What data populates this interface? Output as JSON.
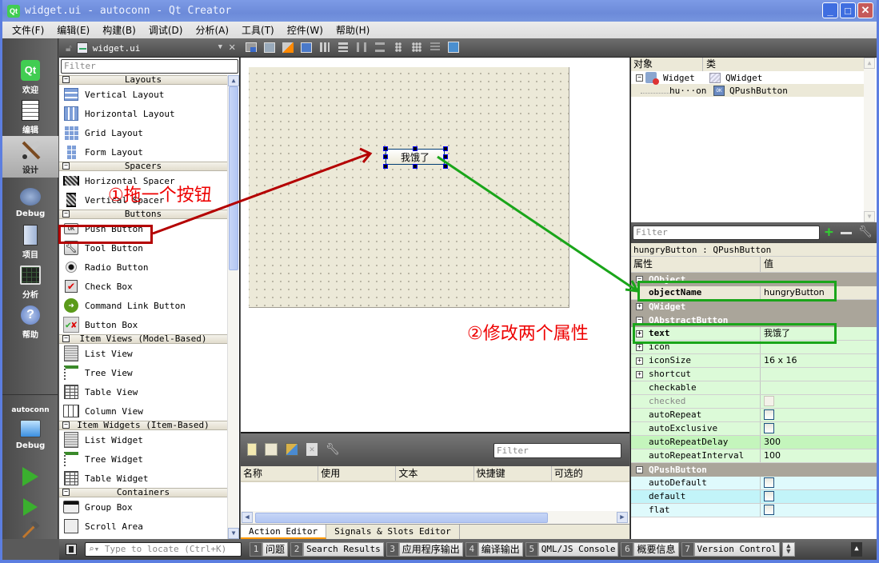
{
  "window": {
    "title": "widget.ui - autoconn - Qt Creator",
    "app_icon": "qt-logo-icon",
    "buttons": [
      "minimize",
      "maximize",
      "close"
    ]
  },
  "menubar": {
    "items": [
      "文件(F)",
      "编辑(E)",
      "构建(B)",
      "调试(D)",
      "分析(A)",
      "工具(T)",
      "控件(W)",
      "帮助(H)"
    ]
  },
  "modebar": {
    "modes": [
      {
        "label": "欢迎",
        "icon": "qt-welcome-icon"
      },
      {
        "label": "编辑",
        "icon": "edit-document-icon"
      },
      {
        "label": "设计",
        "icon": "design-brush-icon",
        "active": true
      },
      {
        "label": "Debug",
        "icon": "debug-bug-icon"
      },
      {
        "label": "项目",
        "icon": "project-folder-icon"
      },
      {
        "label": "分析",
        "icon": "analyze-monitor-icon"
      },
      {
        "label": "帮助",
        "icon": "help-icon"
      }
    ],
    "target": {
      "project": "autoconn",
      "config": "Debug"
    },
    "actions": [
      "run-icon",
      "debug-run-icon",
      "build-hammer-icon"
    ]
  },
  "editor_toolbar": {
    "document": "widget.ui",
    "form_tools": [
      "edit-widgets",
      "edit-signals-slots",
      "edit-buddies",
      "edit-tab-order",
      "layout-horizontal",
      "layout-vertical",
      "layout-horizontal-splitter",
      "layout-vertical-splitter",
      "layout-form",
      "layout-grid",
      "break-layout",
      "adjust-size"
    ]
  },
  "widgetbox": {
    "filter_placeholder": "Filter",
    "categories": [
      {
        "name": "Layouts",
        "items": [
          {
            "label": "Vertical Layout",
            "icon": "vertical-layout-icon"
          },
          {
            "label": "Horizontal Layout",
            "icon": "horizontal-layout-icon"
          },
          {
            "label": "Grid Layout",
            "icon": "grid-layout-icon"
          },
          {
            "label": "Form Layout",
            "icon": "form-layout-icon"
          }
        ]
      },
      {
        "name": "Spacers",
        "items": [
          {
            "label": "Horizontal Spacer",
            "icon": "horizontal-spacer-icon"
          },
          {
            "label": "Vertical Spacer",
            "icon": "vertical-spacer-icon"
          }
        ]
      },
      {
        "name": "Buttons",
        "items": [
          {
            "label": "Push Button",
            "icon": "push-button-icon"
          },
          {
            "label": "Tool Button",
            "icon": "tool-button-icon"
          },
          {
            "label": "Radio Button",
            "icon": "radio-button-icon"
          },
          {
            "label": "Check Box",
            "icon": "check-box-icon"
          },
          {
            "label": "Command Link Button",
            "icon": "command-link-icon"
          },
          {
            "label": "Button Box",
            "icon": "button-box-icon"
          }
        ]
      },
      {
        "name": "Item Views (Model-Based)",
        "items": [
          {
            "label": "List View",
            "icon": "list-view-icon"
          },
          {
            "label": "Tree View",
            "icon": "tree-view-icon"
          },
          {
            "label": "Table View",
            "icon": "table-view-icon"
          },
          {
            "label": "Column View",
            "icon": "column-view-icon"
          }
        ]
      },
      {
        "name": "Item Widgets (Item-Based)",
        "items": [
          {
            "label": "List Widget",
            "icon": "list-widget-icon"
          },
          {
            "label": "Tree Widget",
            "icon": "tree-widget-icon"
          },
          {
            "label": "Table Widget",
            "icon": "table-widget-icon"
          }
        ]
      },
      {
        "name": "Containers",
        "items": [
          {
            "label": "Group Box",
            "icon": "group-box-icon"
          },
          {
            "label": "Scroll Area",
            "icon": "scroll-area-icon"
          }
        ]
      }
    ]
  },
  "form": {
    "button_text": "我饿了"
  },
  "action_editor": {
    "filter_placeholder": "Filter",
    "columns": [
      "名称",
      "使用",
      "文本",
      "快捷键",
      "可选的"
    ],
    "tabs": [
      "Action Editor",
      "Signals & Slots Editor"
    ],
    "active_tab": "Action Editor"
  },
  "object_inspector": {
    "columns": [
      "对象",
      "类"
    ],
    "rows": [
      {
        "object": "Widget",
        "class": "QWidget"
      },
      {
        "object": "hu···on",
        "class": "QPushButton"
      }
    ]
  },
  "property_editor": {
    "filter_placeholder": "Filter",
    "class_line": "hungryButton : QPushButton",
    "columns": [
      "属性",
      "值"
    ],
    "groups": [
      {
        "name": "QObject",
        "expanded": true,
        "props": [
          {
            "name": "objectName",
            "value": "hungryButton",
            "bold": true
          }
        ]
      },
      {
        "name": "QWidget",
        "expanded": false,
        "props": []
      },
      {
        "name": "QAbstractButton",
        "expanded": true,
        "props": [
          {
            "name": "text",
            "value": "我饿了",
            "bold": true,
            "expandable": true
          },
          {
            "name": "icon",
            "value": "",
            "expandable": true
          },
          {
            "name": "iconSize",
            "value": "16 x 16",
            "expandable": true
          },
          {
            "name": "shortcut",
            "value": "",
            "expandable": true
          },
          {
            "name": "checkable",
            "value": ""
          },
          {
            "name": "checked",
            "checkbox": false,
            "disabled": true
          },
          {
            "name": "autoRepeat",
            "checkbox": false
          },
          {
            "name": "autoExclusive",
            "checkbox": false
          },
          {
            "name": "autoRepeatDelay",
            "value": "300"
          },
          {
            "name": "autoRepeatInterval",
            "value": "100"
          }
        ]
      },
      {
        "name": "QPushButton",
        "expanded": true,
        "props": [
          {
            "name": "autoDefault",
            "checkbox": false
          },
          {
            "name": "default",
            "checkbox": false
          },
          {
            "name": "flat",
            "checkbox": false
          }
        ]
      }
    ]
  },
  "output_bar": {
    "locator_placeholder": "Type to locate (Ctrl+K)",
    "panes": [
      {
        "num": "1",
        "label": "问题"
      },
      {
        "num": "2",
        "label": "Search Results"
      },
      {
        "num": "3",
        "label": "应用程序输出"
      },
      {
        "num": "4",
        "label": "编译输出"
      },
      {
        "num": "5",
        "label": "QML/JS Console"
      },
      {
        "num": "6",
        "label": "概要信息"
      },
      {
        "num": "7",
        "label": "Version Control"
      }
    ]
  },
  "annotations": {
    "step1": "①拖一个按钮",
    "step2": "②修改两个属性",
    "step1_color": "#b40000",
    "step2_color": "#1aa51a"
  }
}
